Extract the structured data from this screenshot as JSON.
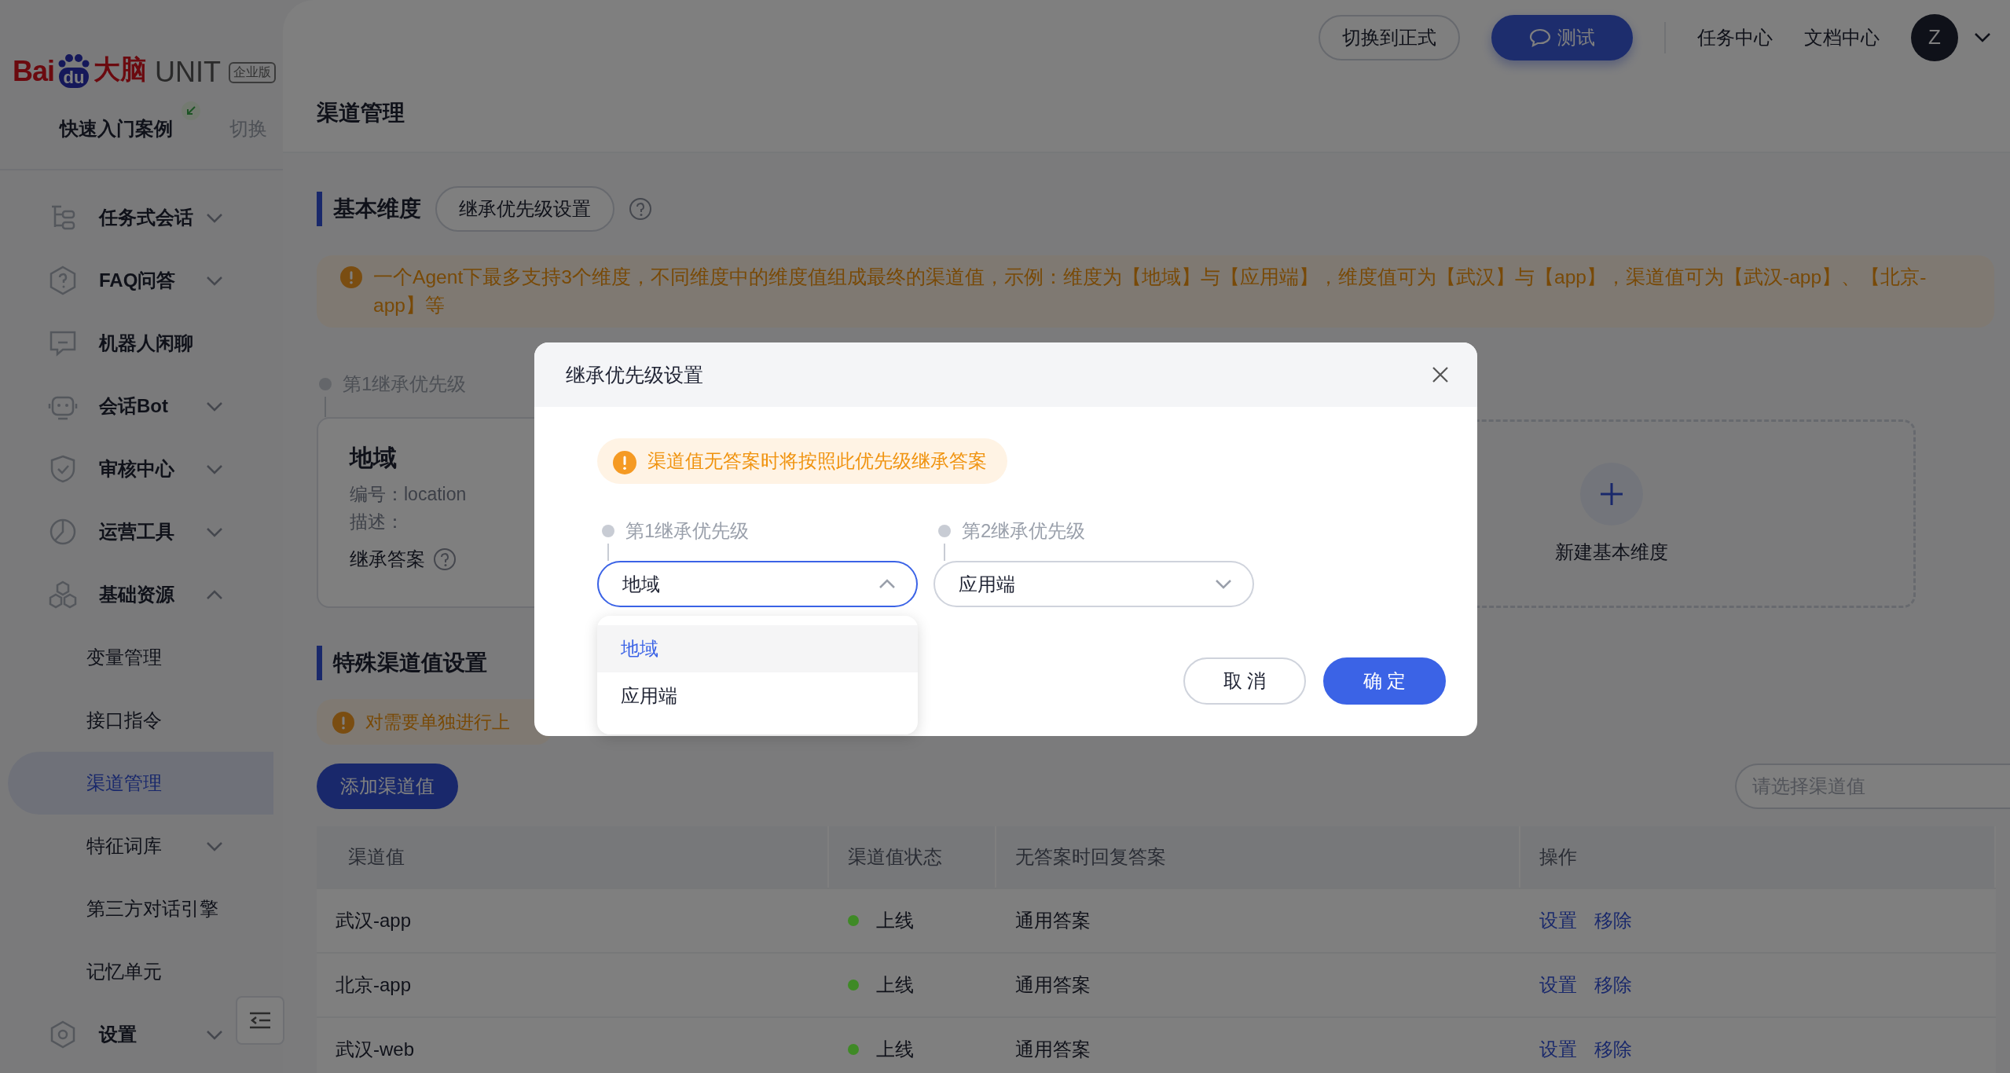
{
  "sidebar": {
    "logo": {
      "brand": "Bai",
      "paw": "du",
      "brand_cn": "大脑",
      "product": "UNIT",
      "edition": "企业版"
    },
    "project": "快速入门案例",
    "switch": "切换",
    "items": [
      {
        "label": "任务式会话",
        "expandable": true,
        "expanded": false,
        "selected": false
      },
      {
        "label": "FAQ问答",
        "expandable": true,
        "expanded": false,
        "selected": false
      },
      {
        "label": "机器人闲聊",
        "expandable": false,
        "selected": false
      },
      {
        "label": "会话Bot",
        "expandable": true,
        "expanded": false,
        "selected": false
      },
      {
        "label": "审核中心",
        "expandable": true,
        "expanded": false,
        "selected": false
      },
      {
        "label": "运营工具",
        "expandable": true,
        "expanded": false,
        "selected": false
      },
      {
        "label": "基础资源",
        "expandable": true,
        "expanded": true,
        "selected": false,
        "children": [
          {
            "label": "变量管理",
            "expandable": false,
            "selected": false
          },
          {
            "label": "接口指令",
            "expandable": false,
            "selected": false
          },
          {
            "label": "渠道管理",
            "expandable": false,
            "selected": true
          },
          {
            "label": "特征词库",
            "expandable": true,
            "expanded": false,
            "selected": false
          },
          {
            "label": "第三方对话引擎",
            "expandable": false,
            "selected": false
          },
          {
            "label": "记忆单元",
            "expandable": false,
            "selected": false
          }
        ]
      },
      {
        "label": "设置",
        "expandable": true,
        "expanded": false,
        "selected": false
      }
    ]
  },
  "header": {
    "buttons": [
      {
        "label": "切换到正式",
        "kind": "outline"
      },
      {
        "label": "测试",
        "kind": "primary"
      }
    ],
    "links": [
      "任务中心",
      "文档中心"
    ],
    "avatar": "Z"
  },
  "page_title": "渠道管理",
  "basic": {
    "title": "基本维度",
    "button": "继承优先级设置",
    "notice": "一个Agent下最多支持3个维度，不同维度中的维度值组成最终的渠道值，示例：维度为【地域】与【应用端】，维度值可为【武汉】与【app】，渠道值可为【武汉-app】、【北京-app】等",
    "dimension": {
      "priority": "第1继承优先级",
      "name": "地域",
      "code_label": "编号：",
      "code": "location",
      "desc_label": "描述：",
      "answer_label": "继承答案"
    },
    "add_label": "新建基本维度"
  },
  "special": {
    "title": "特殊渠道值设置",
    "notice": "对需要单独进行上",
    "add_button": "添加渠道值",
    "search": {
      "placeholder": "请选择渠道值"
    }
  },
  "table": {
    "columns": [
      "渠道值",
      "渠道值状态",
      "无答案时回复答案",
      "操作"
    ],
    "rows": [
      {
        "channel": "武汉-app",
        "status": "上线",
        "color": "#3f8a26",
        "answer": "通用答案",
        "actions": [
          "设置",
          "移除"
        ]
      },
      {
        "channel": "北京-app",
        "status": "上线",
        "color": "#3f8a26",
        "answer": "通用答案",
        "actions": [
          "设置",
          "移除"
        ]
      },
      {
        "channel": "武汉-web",
        "status": "上线",
        "color": "#3f8a26",
        "answer": "通用答案",
        "actions": [
          "设置",
          "移除"
        ]
      }
    ]
  },
  "modal": {
    "title": "继承优先级设置",
    "notice": "渠道值无答案时将按照此优先级继承答案",
    "priorities": [
      {
        "label": "第1继承优先级",
        "value": "地域",
        "open": true
      },
      {
        "label": "第2继承优先级",
        "value": "应用端",
        "open": false
      }
    ],
    "options": [
      {
        "label": "地域",
        "selected": true
      },
      {
        "label": "应用端",
        "selected": false
      }
    ],
    "buttons": [
      {
        "label": "取 消",
        "kind": "default"
      },
      {
        "label": "确 定",
        "kind": "primary"
      }
    ]
  }
}
